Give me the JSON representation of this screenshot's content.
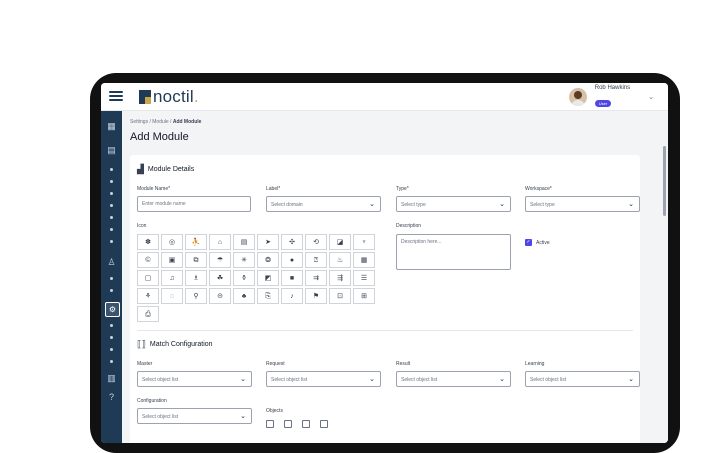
{
  "header": {
    "logo_text": "noctil",
    "logo_dot": ".",
    "user_name": "Rob Hawkins",
    "user_role": "User",
    "colors": {
      "brand": "#1f3a55",
      "accent": "#caa64a",
      "role_badge": "#4f46e5"
    }
  },
  "breadcrumb": {
    "part1": "Settings",
    "sep": "/",
    "part2": "Module",
    "current": "Add Module"
  },
  "page_title": "Add Module",
  "module_details": {
    "title": "Module Details",
    "module_name": {
      "label": "Module Name*",
      "placeholder": "Enter module name"
    },
    "label_field": {
      "label": "Label*",
      "value": "Select domain"
    },
    "type_field": {
      "label": "Type*",
      "value": "Select type"
    },
    "workspace_field": {
      "label": "Workspace*",
      "value": "Select type"
    },
    "icon_label": "Icon",
    "description": {
      "label": "Description",
      "placeholder": "Description here..."
    },
    "active": {
      "label": "Active",
      "checked": true
    },
    "icons": [
      "✽",
      "◎",
      "⛹",
      "⌂",
      "▤",
      "➤",
      "✣",
      "⟲",
      "◪",
      "♆",
      "©",
      "▣",
      "⧉",
      "☂",
      "✳",
      "❂",
      "●",
      "⍰",
      "♨",
      "▦",
      "▢",
      "♫",
      "♗",
      "☘",
      "⚱",
      "◩",
      "■",
      "⇉",
      "⇶",
      "☰",
      "⚘",
      "◌",
      "⚲",
      "⊝",
      "♣",
      "⎘",
      "♪",
      "⚑",
      "⊡",
      "⊞",
      "⎙"
    ]
  },
  "match_config": {
    "title": "Match Configuration",
    "master": {
      "label": "Master",
      "value": "Select object list"
    },
    "request": {
      "label": "Request",
      "value": "Select object list"
    },
    "result": {
      "label": "Result",
      "value": "Select object list"
    },
    "learning": {
      "label": "Learning",
      "value": "Select object list"
    },
    "configuration": {
      "label": "Configuration",
      "value": "Select object list"
    },
    "objects_label": "Objects"
  }
}
